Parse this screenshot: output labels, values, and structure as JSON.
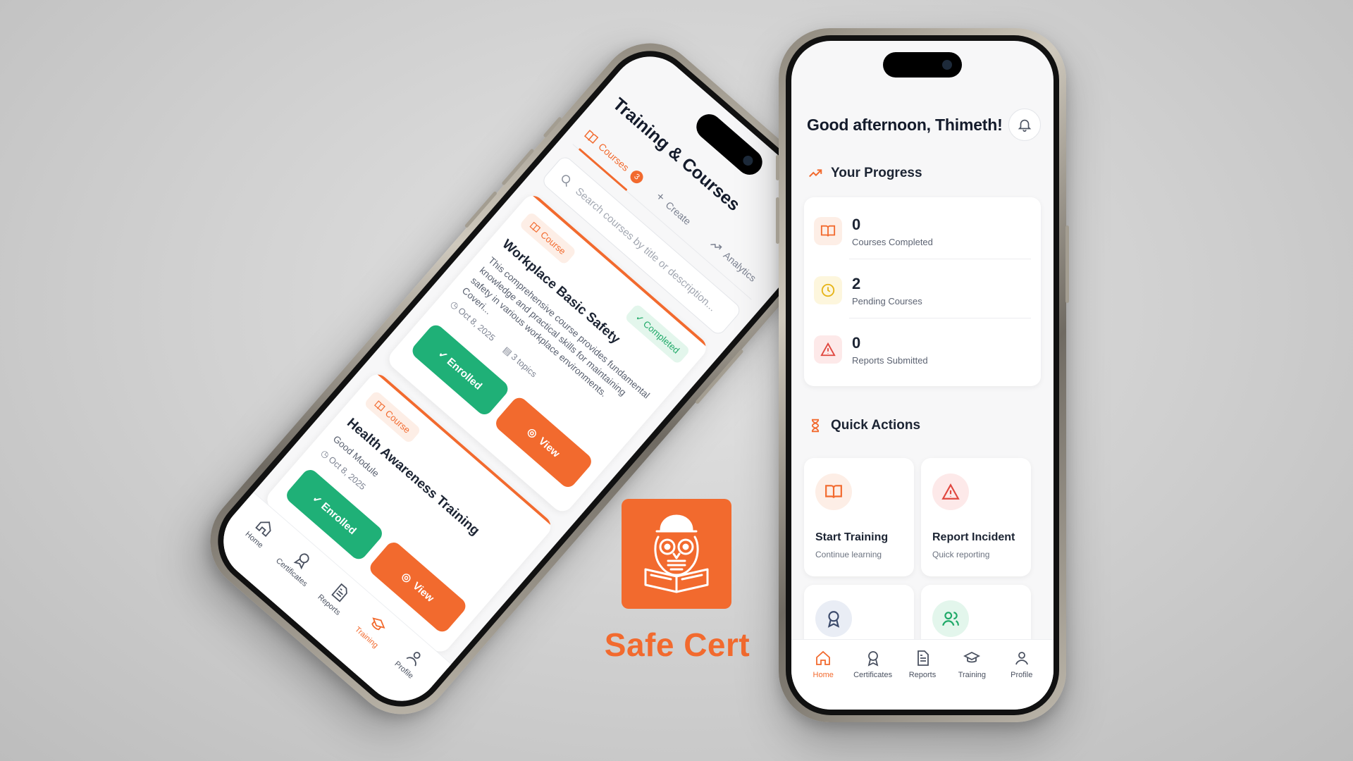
{
  "brand": {
    "name": "Safe Cert",
    "accent": "#f26a2e",
    "success": "#1fb077"
  },
  "home": {
    "greeting": "Good afternoon, Thimeth!",
    "progress_title": "Your Progress",
    "stats": [
      {
        "value": "0",
        "label": "Courses Completed",
        "icon": "book-icon"
      },
      {
        "value": "2",
        "label": "Pending Courses",
        "icon": "clock-icon"
      },
      {
        "value": "0",
        "label": "Reports Submitted",
        "icon": "warning-icon"
      }
    ],
    "quick_actions_title": "Quick Actions",
    "quick_actions": [
      {
        "title": "Start Training",
        "subtitle": "Continue learning",
        "icon": "book-icon"
      },
      {
        "title": "Report Incident",
        "subtitle": "Quick reporting",
        "icon": "warning-icon"
      },
      {
        "title": "",
        "subtitle": "",
        "icon": "award-icon"
      },
      {
        "title": "",
        "subtitle": "",
        "icon": "users-icon"
      }
    ],
    "tabs": [
      {
        "label": "Home",
        "icon": "home-icon",
        "active": true
      },
      {
        "label": "Certificates",
        "icon": "award-icon"
      },
      {
        "label": "Reports",
        "icon": "document-icon"
      },
      {
        "label": "Training",
        "icon": "graduation-cap-icon"
      },
      {
        "label": "Profile",
        "icon": "user-icon"
      }
    ]
  },
  "training": {
    "title": "Training & Courses",
    "tabs": [
      {
        "label": "Courses",
        "badge": "3",
        "active": true
      },
      {
        "label": "Create"
      },
      {
        "label": "Analytics"
      }
    ],
    "search_placeholder": "Search courses by title or description...",
    "courses": [
      {
        "type": "Course",
        "status": "✓ Completed",
        "name": "Workplace Basic Safety",
        "description": "This comprehensive course provides fundamental knowledge and practical skills for maintaining safety in various workplace environments. Coveri...",
        "date": "Oct 8, 2025",
        "topics": "3 topics",
        "enrolled_label": "✓ Enrolled",
        "view_label": "View"
      },
      {
        "type": "Course",
        "status": "",
        "name": "Health Awareness Training",
        "description": "Good Module",
        "date": "Oct 8, 2025",
        "topics": "",
        "enrolled_label": "✓ Enrolled",
        "view_label": "View"
      }
    ],
    "tabs_bottom": [
      {
        "label": "Home"
      },
      {
        "label": "Certificates"
      },
      {
        "label": "Reports"
      },
      {
        "label": "Training",
        "active": true
      },
      {
        "label": "Profile"
      }
    ]
  }
}
